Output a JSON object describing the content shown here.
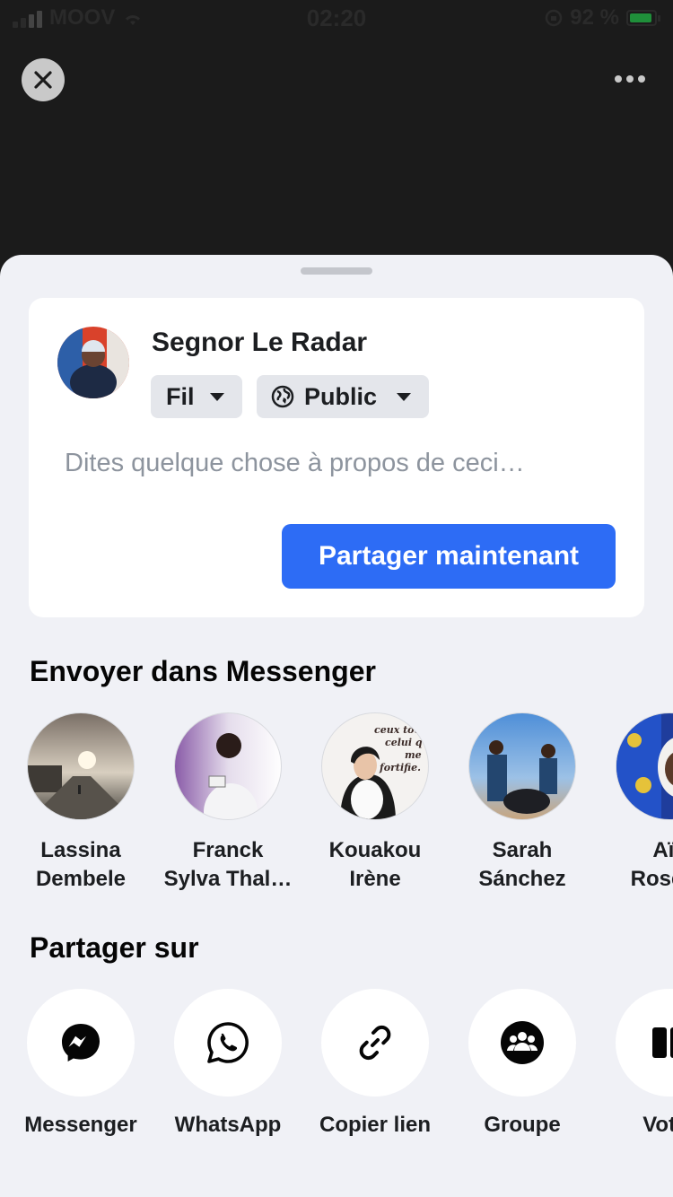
{
  "status_bar": {
    "carrier": "MOOV",
    "time": "02:20",
    "battery_text": "92 %",
    "battery_level": 0.92
  },
  "composer": {
    "user_name": "Segnor Le Radar",
    "audience_feed": "Fil",
    "audience_privacy": "Public",
    "caption_placeholder": "Dites quelque chose à propos de ceci…",
    "share_button": "Partager maintenant"
  },
  "messenger_section": {
    "title": "Envoyer dans Messenger",
    "contacts": [
      {
        "line1": "Lassina",
        "line2": "Dembele"
      },
      {
        "line1": "Franck",
        "line2": "Sylva Thal…"
      },
      {
        "line1": "Kouakou",
        "line2": "Irène"
      },
      {
        "line1": "Sarah",
        "line2": "Sánchez"
      },
      {
        "line1": "Aïc",
        "line2": "Roselin"
      }
    ],
    "avatar_overlay_text": [
      "ceux tou",
      "celui q",
      "me",
      "fortifie."
    ]
  },
  "share_on_section": {
    "title": "Partager sur",
    "targets": [
      {
        "label": "Messenger",
        "icon": "messenger-icon"
      },
      {
        "label": "WhatsApp",
        "icon": "whatsapp-icon"
      },
      {
        "label": "Copier lien",
        "icon": "link-icon"
      },
      {
        "label": "Groupe",
        "icon": "group-icon"
      },
      {
        "label": "Votre",
        "icon": "story-icon"
      }
    ]
  },
  "colors": {
    "accent": "#2d6cf5",
    "sheet_bg": "#f0f1f6",
    "backdrop": "#1b1b1b"
  }
}
